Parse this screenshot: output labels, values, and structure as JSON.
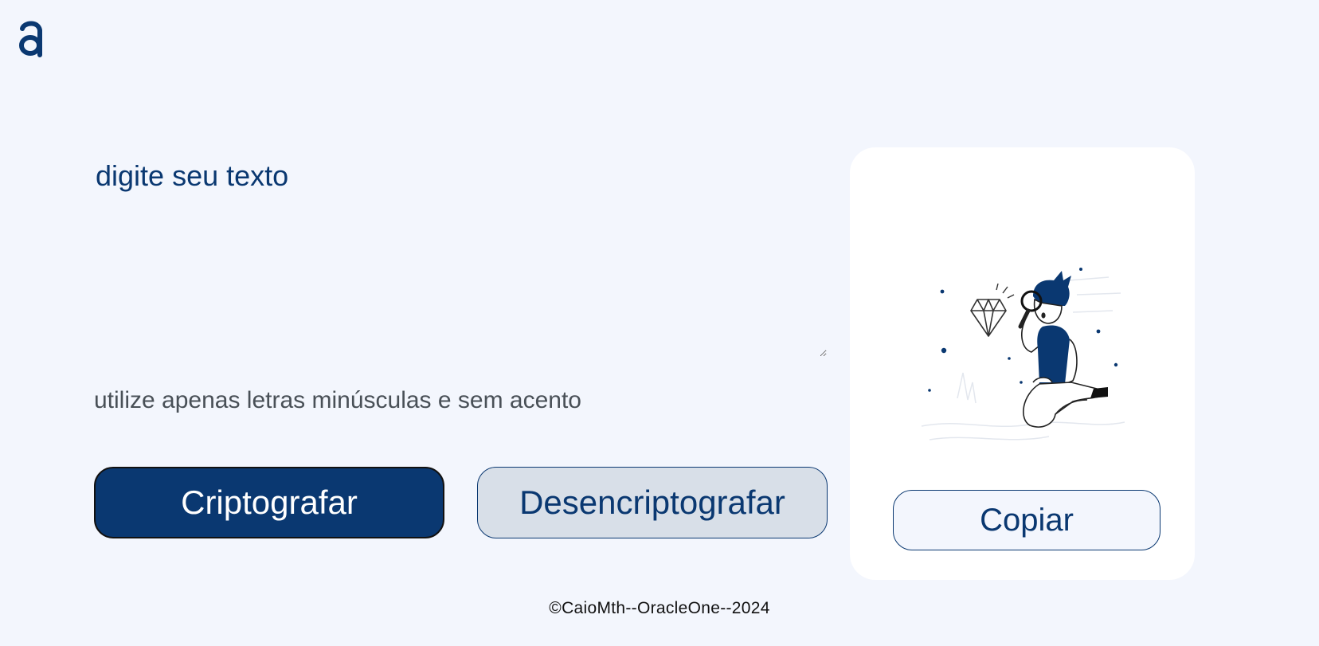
{
  "app": {
    "logo_icon": "alura-a-logo-icon",
    "accent_color": "#0a3871",
    "background_color": "#f3f6fd"
  },
  "input": {
    "placeholder": "digite seu texto",
    "value": ""
  },
  "hint": {
    "text": "utilize apenas letras minúsculas e sem acento"
  },
  "buttons": {
    "encrypt_label": "Criptografar",
    "decrypt_label": "Desencriptografar"
  },
  "output": {
    "illustration_icon": "person-magnifying-glass-diamond-icon",
    "copy_label": "Copiar"
  },
  "footer": {
    "text": "©CaioMth--OracleOne--2024"
  }
}
